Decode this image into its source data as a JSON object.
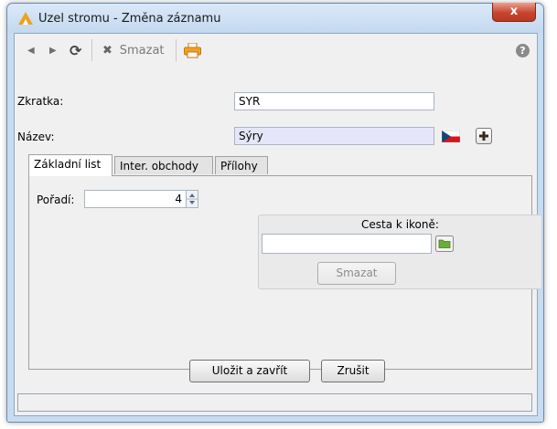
{
  "window": {
    "title": "Uzel stromu - Změna záznamu",
    "close_label": "x"
  },
  "toolbar": {
    "back_icon": "◀",
    "forward_icon": "▶",
    "refresh_icon": "⟳",
    "delete_label": "Smazat",
    "delete_icon": "✖",
    "help_icon": "?"
  },
  "form": {
    "zkratka_label": "Zkratka:",
    "zkratka_value": "SYR",
    "nazev_label": "Název:",
    "nazev_value": "Sýry"
  },
  "tabs": [
    {
      "label": "Základní list",
      "active": true
    },
    {
      "label": "Inter. obchody",
      "active": false
    },
    {
      "label": "Přílohy",
      "active": false
    }
  ],
  "basic": {
    "poradi_label": "Pořadí:",
    "poradi_value": "4",
    "icon_path_label": "Cesta k ikoně:",
    "icon_path_value": "",
    "icon_delete_label": "Smazat"
  },
  "actions": {
    "save_close_label": "Uložit a zavřít",
    "cancel_label": "Zrušit"
  },
  "status": {
    "text": ""
  },
  "colors": {
    "nazev_field_bg": "#e6e6fa",
    "accent_orange": "#f0a020",
    "close_red": "#c8452f",
    "folder_green": "#6cae3a"
  }
}
